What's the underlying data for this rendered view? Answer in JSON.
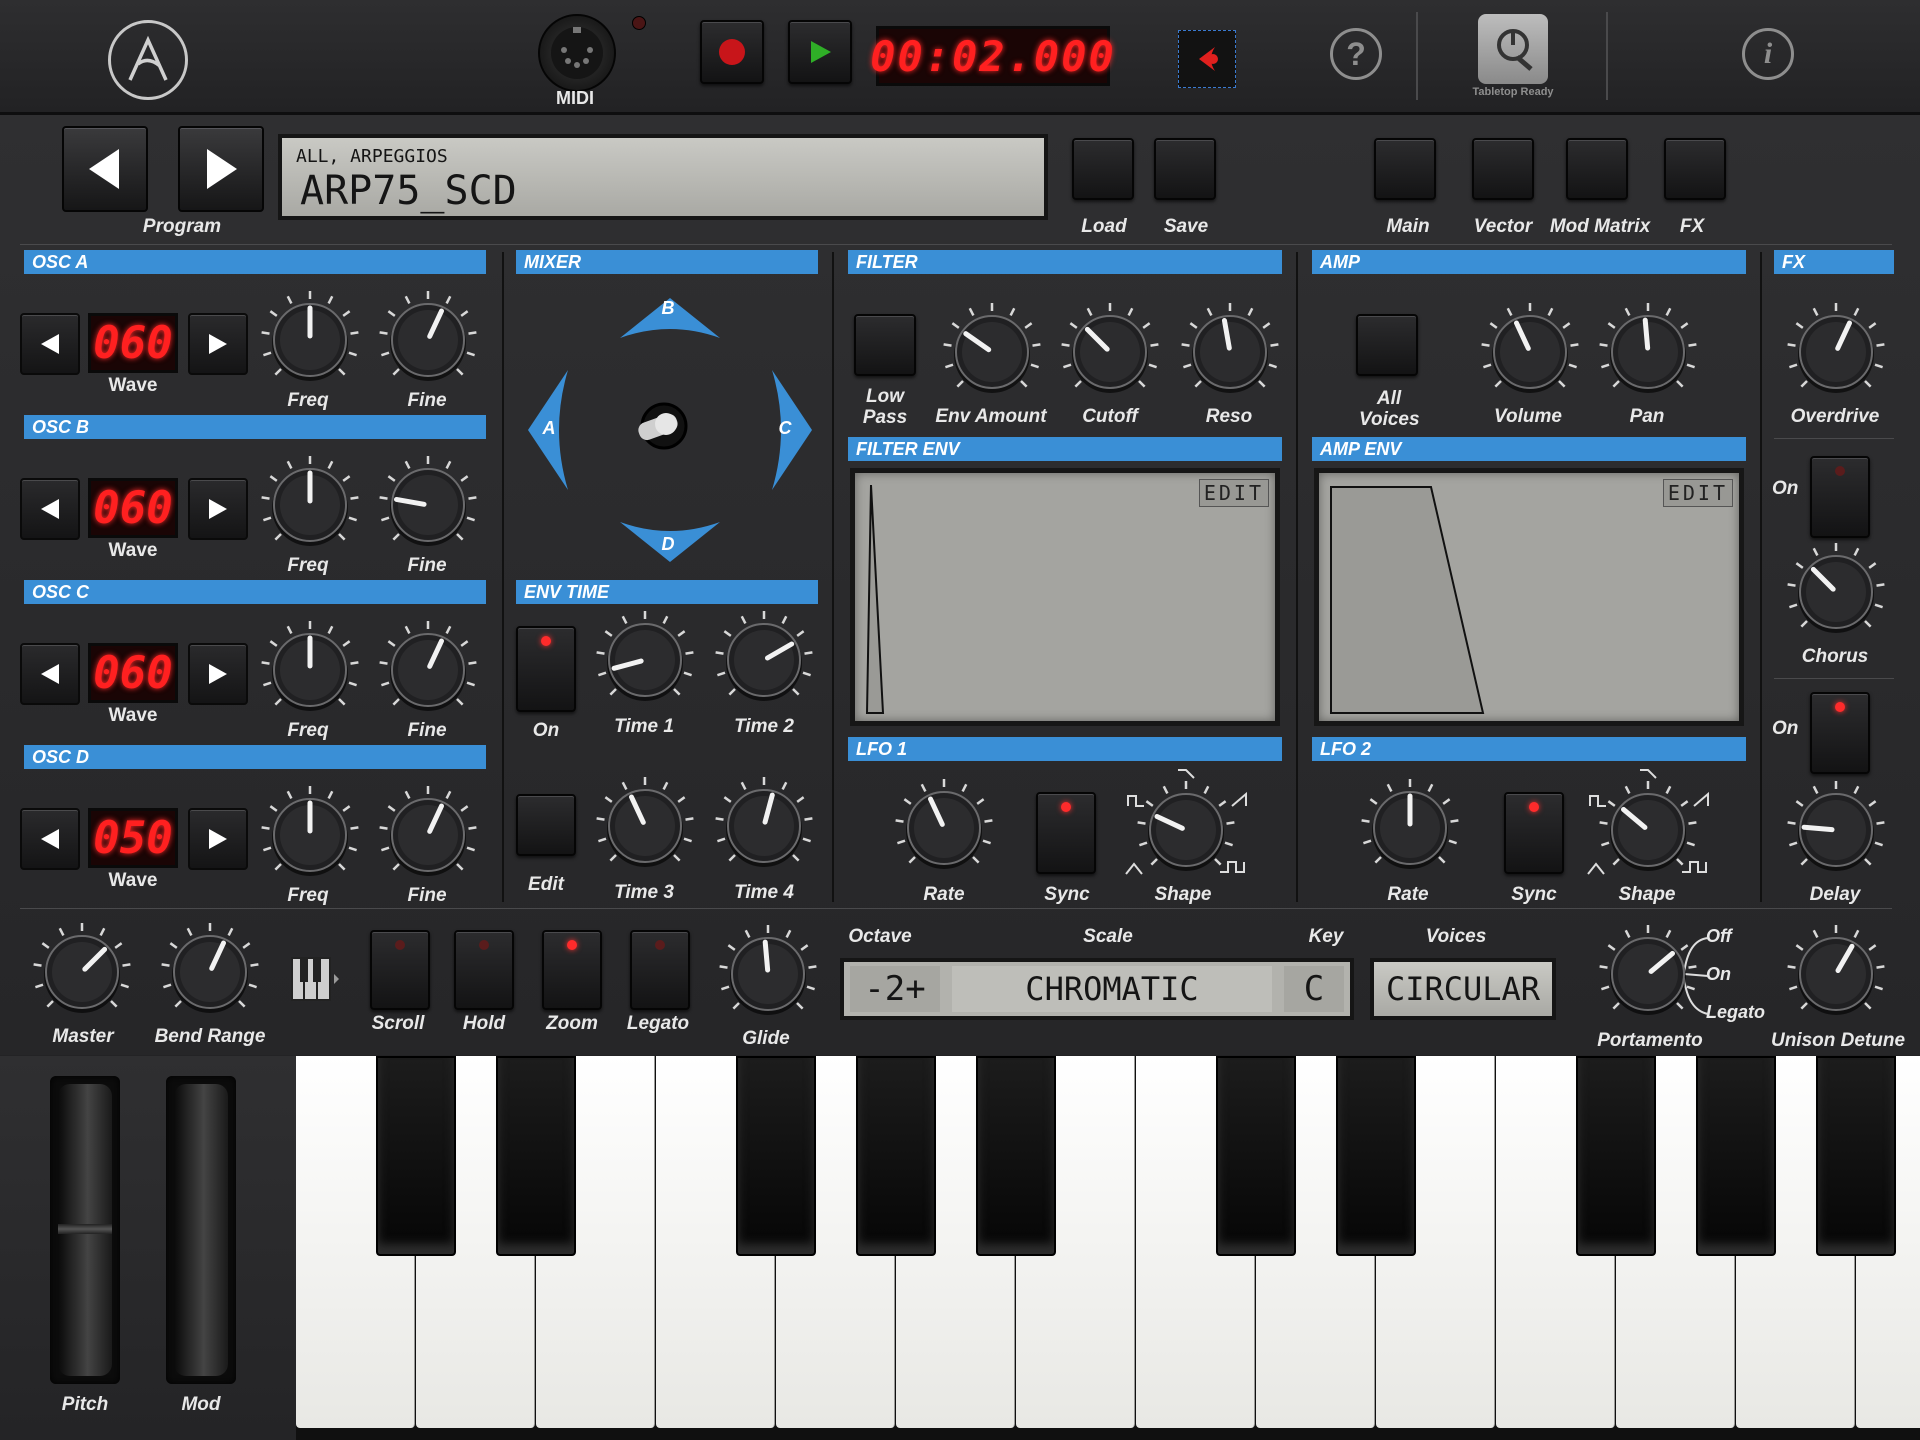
{
  "colors": {
    "accent_blue": "#3a8fd6",
    "led_red": "#ff2b2b",
    "lcd": "#b8b8b3",
    "panel": "#2b2b2d"
  },
  "topbar": {
    "logo_icon": "arturia-logo-icon",
    "midi_label": "MIDI",
    "timer": "00:02.000",
    "help_icon": "help-icon",
    "tabletop_label": "Tabletop Ready",
    "info_icon": "info-icon"
  },
  "program": {
    "label": "Program",
    "category": "ALL, ARPEGGIOS",
    "name": "ARP75_SCD",
    "load": "Load",
    "save": "Save",
    "views": [
      "Main",
      "Vector",
      "Mod Matrix",
      "FX"
    ]
  },
  "osc": [
    {
      "title": "OSC A",
      "value": "060",
      "wave": "Wave",
      "freq": "Freq",
      "fine": "Fine",
      "freq_angle": 0,
      "fine_angle": 25
    },
    {
      "title": "OSC B",
      "value": "060",
      "wave": "Wave",
      "freq": "Freq",
      "fine": "Fine",
      "freq_angle": 0,
      "fine_angle": -80
    },
    {
      "title": "OSC C",
      "value": "060",
      "wave": "Wave",
      "freq": "Freq",
      "fine": "Fine",
      "freq_angle": 0,
      "fine_angle": 25
    },
    {
      "title": "OSC D",
      "value": "050",
      "wave": "Wave",
      "freq": "Freq",
      "fine": "Fine",
      "freq_angle": 0,
      "fine_angle": 25
    }
  ],
  "mixer": {
    "title": "MIXER",
    "a": "A",
    "b": "B",
    "c": "C",
    "d": "D"
  },
  "env_time": {
    "title": "ENV TIME",
    "on": "On",
    "edit": "Edit",
    "time1": "Time 1",
    "time2": "Time 2",
    "time3": "Time 3",
    "time4": "Time 4"
  },
  "filter": {
    "title": "FILTER",
    "low_pass": "Low Pass",
    "env_amount": "Env Amount",
    "cutoff": "Cutoff",
    "reso": "Reso"
  },
  "filter_env": {
    "title": "FILTER ENV",
    "edit": "EDIT"
  },
  "amp": {
    "title": "AMP",
    "all_voices": "All Voices",
    "volume": "Volume",
    "pan": "Pan"
  },
  "amp_env": {
    "title": "AMP ENV",
    "edit": "EDIT"
  },
  "lfo1": {
    "title": "LFO 1",
    "rate": "Rate",
    "sync": "Sync",
    "shape": "Shape"
  },
  "lfo2": {
    "title": "LFO 2",
    "rate": "Rate",
    "sync": "Sync",
    "shape": "Shape"
  },
  "fx": {
    "title": "FX",
    "overdrive": "Overdrive",
    "on1": "On",
    "chorus": "Chorus",
    "on2": "On",
    "delay": "Delay"
  },
  "bottom": {
    "master": "Master",
    "bend_range": "Bend Range",
    "scroll": "Scroll",
    "hold": "Hold",
    "zoom": "Zoom",
    "legato": "Legato",
    "glide": "Glide",
    "octave_label": "Octave",
    "scale_label": "Scale",
    "key_label": "Key",
    "voices_label": "Voices",
    "octave_value": "-2+",
    "scale_value": "CHROMATIC",
    "key_value": "C",
    "voices_value": "CIRCULAR",
    "portamento": "Portamento",
    "porta_off": "Off",
    "porta_on": "On",
    "porta_legato": "Legato",
    "unison_detune": "Unison Detune"
  },
  "keyboard": {
    "pitch": "Pitch",
    "mod": "Mod"
  }
}
